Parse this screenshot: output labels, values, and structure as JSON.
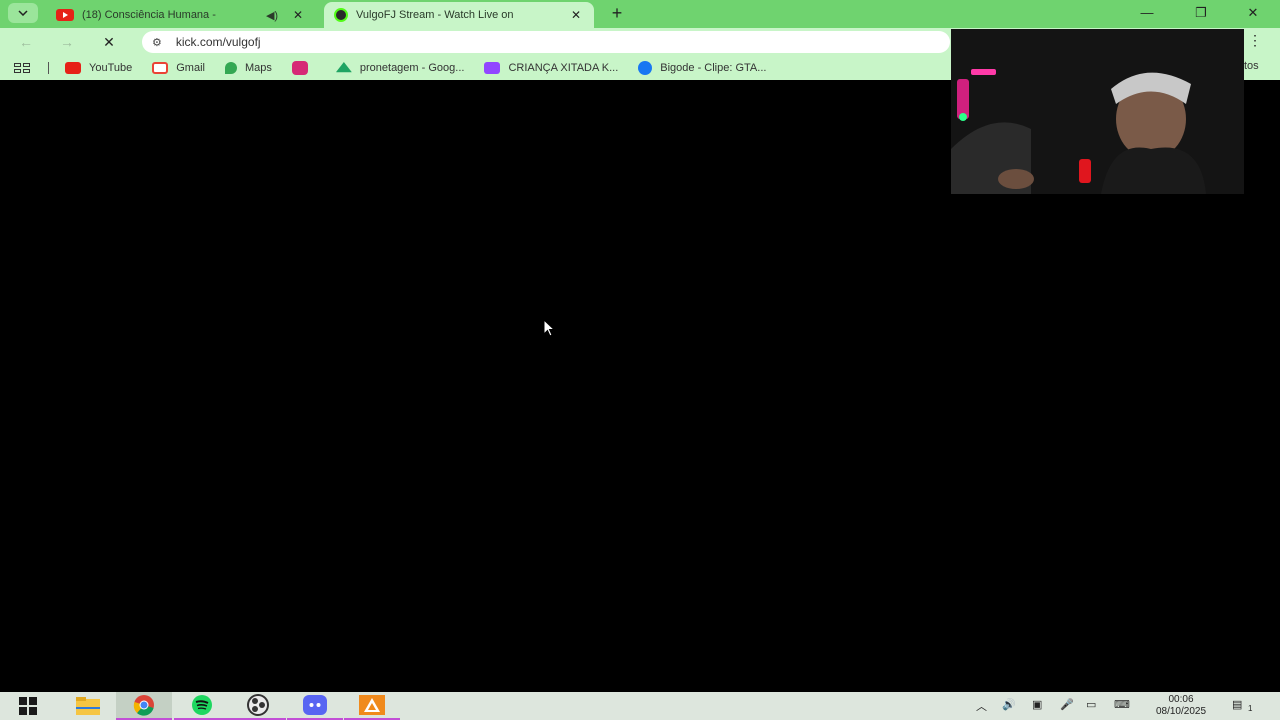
{
  "browser": {
    "tabs": [
      {
        "title": "(18) Consciência Humana -",
        "favicon": "youtube-icon",
        "state": "inactive",
        "audio": true
      },
      {
        "title": "VulgoFJ Stream - Watch Live on",
        "favicon": "kick-icon",
        "state": "active",
        "audio": false
      }
    ],
    "url": "kick.com/vulgofj",
    "bookmarks": [
      {
        "label": "YouTube",
        "icon": "youtube-icon",
        "color": "#e62117"
      },
      {
        "label": "Gmail",
        "icon": "gmail-icon",
        "color": "#ea4335"
      },
      {
        "label": "Maps",
        "icon": "maps-icon",
        "color": "#34a853"
      },
      {
        "label": "",
        "icon": "instagram-icon",
        "color": "#d62976"
      },
      {
        "label": "pronetagem - Goog...",
        "icon": "drive-icon",
        "color": "#1fa463"
      },
      {
        "label": "CRIANÇA XITADA K...",
        "icon": "twitch-icon",
        "color": "#9146ff"
      },
      {
        "label": "Bigode - Clipe: GTA...",
        "icon": "facebook-icon",
        "color": "#1877f2"
      }
    ],
    "bookmarks_overflow": "tos"
  },
  "taskbar": {
    "apps": [
      "windows-start-icon",
      "file-explorer-icon",
      "chrome-icon",
      "spotify-icon",
      "obs-icon",
      "discord-icon",
      "app-icon"
    ],
    "time": "00:06",
    "date": "08/10/2025",
    "notification_count": "1"
  }
}
